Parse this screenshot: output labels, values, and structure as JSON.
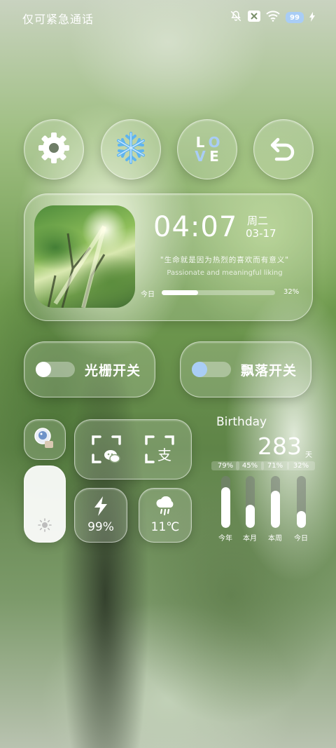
{
  "status_bar": {
    "text": "仅可紧急通话",
    "battery": "99"
  },
  "round_buttons": [
    {
      "icon": "gear-icon"
    },
    {
      "icon": "snowflake-icon"
    },
    {
      "icon": "love-icon",
      "letters": [
        "L",
        "O",
        "V",
        "E"
      ]
    },
    {
      "icon": "back-arrow-icon"
    }
  ],
  "main_card": {
    "time": "04:07",
    "weekday": "周二",
    "date": "03-17",
    "quote_cn": "\"生命就是因为热烈的喜欢而有意义\"",
    "quote_en": "Passionate and meaningful liking",
    "progress_label": "今日",
    "progress_value": 0.32,
    "progress_text": "32%"
  },
  "switches": [
    {
      "label": "光栅开关",
      "knob_color": "#ffffff"
    },
    {
      "label": "飘落开关",
      "knob_color": "#a9cdf5"
    }
  ],
  "tiles": {
    "battery": {
      "icon": "lightning-icon",
      "value": "99%"
    },
    "weather": {
      "icon": "rain-cloud-icon",
      "value": "11℃"
    },
    "scan_wechat": {
      "icon": "wechat-scan-icon"
    },
    "scan_alipay": {
      "icon": "alipay-scan-icon",
      "glyph": "支"
    }
  },
  "brightness": {
    "icon": "sun-icon"
  },
  "birthday": {
    "title": "Birthday",
    "days": "283",
    "unit": "天",
    "bars": [
      {
        "label": "今年",
        "value": 0.79,
        "text": "79%"
      },
      {
        "label": "本月",
        "value": 0.45,
        "text": "45%"
      },
      {
        "label": "本周",
        "value": 0.71,
        "text": "71%"
      },
      {
        "label": "今日",
        "value": 0.32,
        "text": "32%"
      }
    ]
  }
}
